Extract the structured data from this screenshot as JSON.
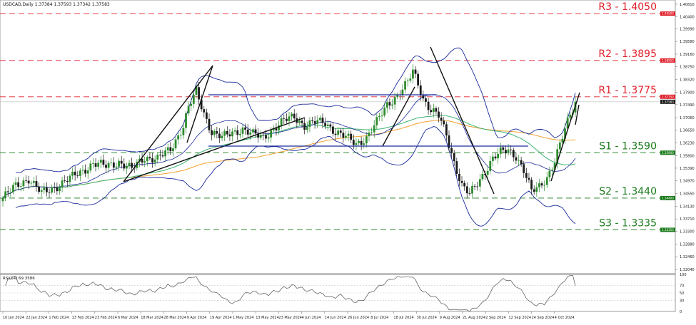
{
  "header": {
    "symbol_info": "USDCAD,Daily  1.37384 1.37593 1.37342 1.37583"
  },
  "rsi_panel": {
    "label": "RSI(14) 69.3586",
    "value": 69.3586,
    "levels": [
      "100",
      "70",
      "50",
      "30",
      "0"
    ]
  },
  "price_axis": {
    "ticks": [
      "1.40810",
      "1.40400",
      "1.39990",
      "1.39580",
      "1.39160",
      "1.38750",
      "1.38320",
      "1.37900",
      "1.37490",
      "1.37060",
      "1.36650",
      "1.36230",
      "1.35800",
      "1.35390",
      "1.34970",
      "1.34550",
      "1.34130",
      "1.33710",
      "1.33300",
      "1.32880",
      "1.32460",
      "1.32040"
    ],
    "current_price_label": "1.37583"
  },
  "date_axis": {
    "labels": [
      "10 Jan 2024",
      "22 Jan 2024",
      "1 Feb 2024",
      "13 Feb 2024",
      "23 Feb 2024",
      "6 Mar 2024",
      "18 Mar 2024",
      "28 Mar 2024",
      "9 Apr 2024",
      "19 Apr 2024",
      "1 May 2024",
      "13 May 2024",
      "23 May 2024",
      "4 Jun 2024",
      "14 Jun 2024",
      "26 Jun 2024",
      "8 Jul 2024",
      "18 Jul 2024",
      "30 Jul 2024",
      "9 Aug 2024",
      "21 Aug 2024",
      "2 Sep 2024",
      "12 Sep 2024",
      "24 Sep 2024",
      "4 Oct 2024"
    ]
  },
  "levels": [
    {
      "id": "r3",
      "label": "R3 - 1.4050",
      "price": 1.405,
      "tag": "1.40500",
      "color": "#e0202a"
    },
    {
      "id": "r2",
      "label": "R2 - 1.3895",
      "price": 1.3895,
      "tag": "1.38950",
      "color": "#e0202a"
    },
    {
      "id": "r1",
      "label": "R1 - 1.3775",
      "price": 1.3775,
      "tag": "1.37750",
      "color": "#e0202a"
    },
    {
      "id": "s1",
      "label": "S1 - 1.3590",
      "price": 1.359,
      "tag": "1.35900",
      "color": "#1a7a1a"
    },
    {
      "id": "s2",
      "label": "S2 - 1.3440",
      "price": 1.344,
      "tag": "1.34400",
      "color": "#1a7a1a"
    },
    {
      "id": "s3",
      "label": "S3 - 1.3335",
      "price": 1.3335,
      "tag": "1.33350",
      "color": "#1a7a1a"
    }
  ],
  "colors": {
    "bull_candle": "#2e8b2e",
    "bear_candle": "#1a1a1a",
    "bollinger": "#1a2a9a",
    "ma_green": "#3cb371",
    "ma_orange": "#f0a030",
    "range_box": "#1a2a9a",
    "rsi_line": "#666666"
  },
  "chart_data": {
    "type": "candlestick",
    "symbol": "USDCAD",
    "timeframe": "Daily",
    "ylim": [
      1.319,
      1.4095
    ],
    "close_series_anchors": [
      [
        0,
        1.344
      ],
      [
        5,
        1.348
      ],
      [
        10,
        1.3505
      ],
      [
        15,
        1.3455
      ],
      [
        20,
        1.3475
      ],
      [
        25,
        1.35
      ],
      [
        30,
        1.3525
      ],
      [
        35,
        1.3555
      ],
      [
        40,
        1.3545
      ],
      [
        45,
        1.356
      ],
      [
        50,
        1.3535
      ],
      [
        55,
        1.3575
      ],
      [
        60,
        1.357
      ],
      [
        65,
        1.36
      ],
      [
        70,
        1.368
      ],
      [
        72,
        1.374
      ],
      [
        75,
        1.379
      ],
      [
        78,
        1.372
      ],
      [
        81,
        1.366
      ],
      [
        85,
        1.364
      ],
      [
        89,
        1.3655
      ],
      [
        93,
        1.367
      ],
      [
        97,
        1.365
      ],
      [
        101,
        1.364
      ],
      [
        105,
        1.367
      ],
      [
        109,
        1.3695
      ],
      [
        113,
        1.371
      ],
      [
        117,
        1.368
      ],
      [
        121,
        1.369
      ],
      [
        125,
        1.369
      ],
      [
        129,
        1.366
      ],
      [
        133,
        1.364
      ],
      [
        137,
        1.362
      ],
      [
        141,
        1.364
      ],
      [
        145,
        1.369
      ],
      [
        149,
        1.375
      ],
      [
        153,
        1.378
      ],
      [
        157,
        1.382
      ],
      [
        159,
        1.386
      ],
      [
        161,
        1.382
      ],
      [
        163,
        1.377
      ],
      [
        166,
        1.373
      ],
      [
        169,
        1.371
      ],
      [
        172,
        1.365
      ],
      [
        175,
        1.356
      ],
      [
        178,
        1.348
      ],
      [
        181,
        1.345
      ],
      [
        184,
        1.349
      ],
      [
        187,
        1.353
      ],
      [
        190,
        1.357
      ],
      [
        193,
        1.359
      ],
      [
        196,
        1.36
      ],
      [
        199,
        1.358
      ],
      [
        202,
        1.353
      ],
      [
        205,
        1.346
      ],
      [
        208,
        1.348
      ],
      [
        211,
        1.351
      ],
      [
        214,
        1.356
      ],
      [
        217,
        1.364
      ],
      [
        220,
        1.372
      ],
      [
        222,
        1.3758
      ]
    ]
  }
}
